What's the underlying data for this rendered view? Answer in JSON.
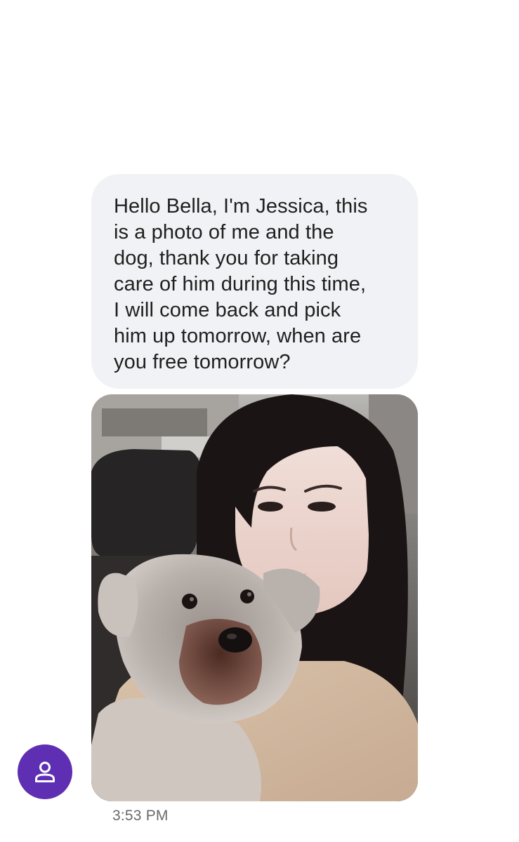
{
  "conversation": {
    "message": {
      "text": "Hello Bella, I'm Jessica, this is a photo of me and the dog, thank you for taking care of him during this time, I will come back and pick him up tomorrow, when are you free tomorrow?",
      "lines": [
        "Hello Bella, I'm Jessica, this",
        "is a photo of me and the",
        "dog, thank you for taking",
        "care of him during this time,",
        "I will come back and pick",
        "him up tomorrow, when are",
        "you free tomorrow?"
      ]
    },
    "attachment": {
      "type": "photo"
    },
    "timestamp": "3:53 PM",
    "sender_avatar": {
      "icon": "person-icon"
    }
  },
  "colors": {
    "bubble_background": "#f1f2f5",
    "message_text": "#1f1f1f",
    "avatar_background": "#5e2fb2",
    "timestamp_text": "#6a6a6a"
  }
}
